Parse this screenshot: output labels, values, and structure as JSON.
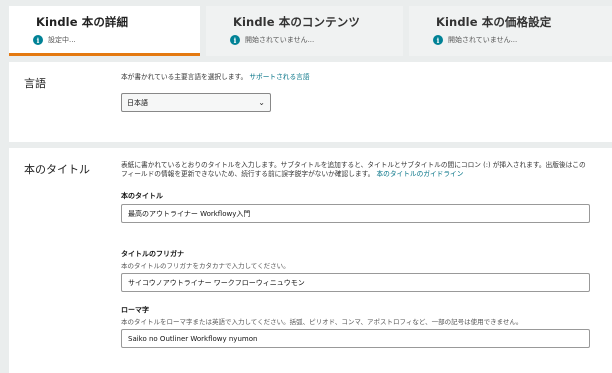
{
  "tabs": [
    {
      "title": "Kindle 本の詳細",
      "status": "設定中..."
    },
    {
      "title": "Kindle 本のコンテンツ",
      "status": "開始されていません..."
    },
    {
      "title": "Kindle 本の価格設定",
      "status": "開始されていません..."
    }
  ],
  "language": {
    "label": "言語",
    "help": "本が書かれている主要言語を選択します。",
    "link": "サポートされる言語",
    "selected": "日本語"
  },
  "book_title": {
    "label": "本のタイトル",
    "help": "表紙に書かれているとおりのタイトルを入力します。サブタイトルを追加すると、タイトルとサブタイトルの間にコロン (:) が挿入されます。出版後はこのフィールドの情報を更新できないため、続行する前に誤字脱字がないか確認します。",
    "guide_link": "本のタイトルのガイドライン",
    "title_field": {
      "label": "本のタイトル",
      "value": "最高のアウトライナー Workflowy入門"
    },
    "furigana_field": {
      "label": "タイトルのフリガナ",
      "help": "本のタイトルのフリガナをカタカナで入力してください。",
      "value": "サイコウノアウトライナー ワークフローウィニュウモン"
    },
    "romaji_field": {
      "label": "ローマ字",
      "help": "本のタイトルをローマ字または英語で入力してください。括弧、ピリオド、コンマ、アポストロフィなど、一部の記号は使用できません。",
      "value": "Saiko no Outliner Workflowy nyumon"
    }
  },
  "colors": {
    "accent": "#e47911",
    "link": "#007185",
    "info": "#008296"
  },
  "icons": [
    "info-icon",
    "chevron-down-icon"
  ]
}
